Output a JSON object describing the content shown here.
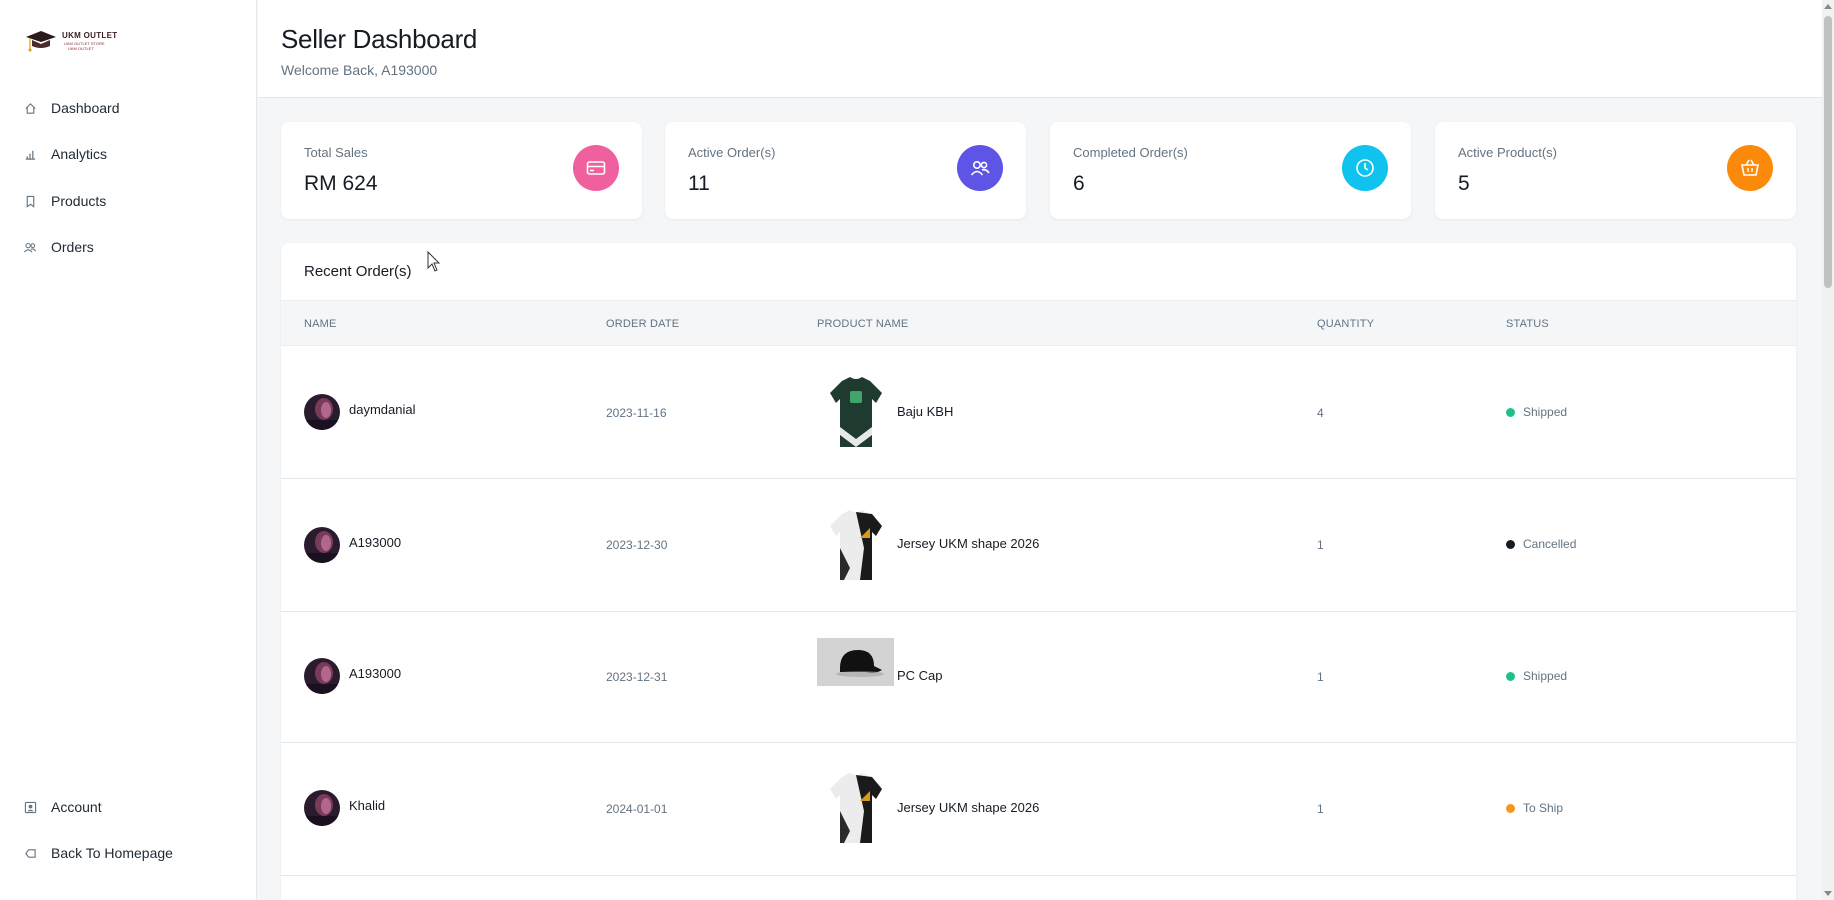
{
  "brand": {
    "name": "UKM OUTLET",
    "tagline": "UKM OUTLET STORE",
    "tagline2": "UKM OUTLET"
  },
  "sidebar": {
    "items": [
      {
        "label": "Dashboard",
        "icon": "home-icon"
      },
      {
        "label": "Analytics",
        "icon": "bar-chart-icon"
      },
      {
        "label": "Products",
        "icon": "bookmark-icon"
      },
      {
        "label": "Orders",
        "icon": "users-icon"
      }
    ],
    "bottom": [
      {
        "label": "Account",
        "icon": "account-icon"
      },
      {
        "label": "Back To Homepage",
        "icon": "back-icon"
      }
    ]
  },
  "header": {
    "title": "Seller Dashboard",
    "subtitle": "Welcome Back, A193000"
  },
  "stats": [
    {
      "label": "Total Sales",
      "value": "RM 624",
      "icon": "credit-card-icon",
      "color": "#f0609e"
    },
    {
      "label": "Active Order(s)",
      "value": "11",
      "icon": "users-icon",
      "color": "#5e55e6"
    },
    {
      "label": "Completed Order(s)",
      "value": "6",
      "icon": "clock-icon",
      "color": "#0fc3ee"
    },
    {
      "label": "Active Product(s)",
      "value": "5",
      "icon": "cart-icon",
      "color": "#fb8a0a"
    }
  ],
  "orders": {
    "title": "Recent Order(s)",
    "columns": [
      "NAME",
      "ORDER DATE",
      "PRODUCT NAME",
      "QUANTITY",
      "STATUS"
    ],
    "rows": [
      {
        "name": "daymdanial",
        "date": "2023-11-16",
        "product": "Baju KBH",
        "product_img": "dark-jersey",
        "quantity": "4",
        "status": "Shipped",
        "status_color": "#1fc08a"
      },
      {
        "name": "A193000",
        "date": "2023-12-30",
        "product": "Jersey UKM shape 2026",
        "product_img": "white-jersey",
        "quantity": "1",
        "status": "Cancelled",
        "status_color": "#161c24"
      },
      {
        "name": "A193000",
        "date": "2023-12-31",
        "product": "PC Cap",
        "product_img": "cap",
        "quantity": "1",
        "status": "Shipped",
        "status_color": "#1fc08a"
      },
      {
        "name": "Khalid",
        "date": "2024-01-01",
        "product": "Jersey UKM shape 2026",
        "product_img": "white-jersey",
        "quantity": "1",
        "status": "To Ship",
        "status_color": "#f7941d"
      }
    ]
  }
}
